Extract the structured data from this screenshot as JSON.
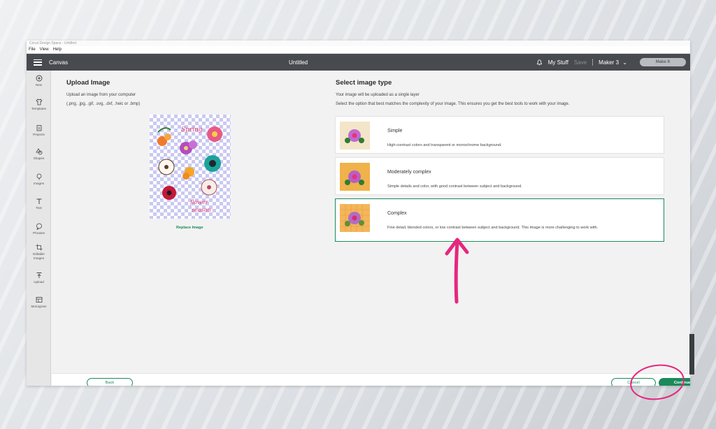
{
  "window": {
    "title": "Cricut Design Space - Untitled"
  },
  "menu": {
    "items": [
      "File",
      "View",
      "Help"
    ]
  },
  "topbar": {
    "app_label": "Canvas",
    "doc_title": "Untitled",
    "my_stuff": "My Stuff",
    "save": "Save",
    "machine": "Maker 3",
    "make_it": "Make It"
  },
  "sidebar": {
    "items": [
      {
        "label": "New",
        "icon": "plus-circle-icon"
      },
      {
        "label": "Templates",
        "icon": "shirt-icon"
      },
      {
        "label": "Projects",
        "icon": "clipboard-icon"
      },
      {
        "label": "Shapes",
        "icon": "shapes-icon"
      },
      {
        "label": "Images",
        "icon": "lightbulb-icon"
      },
      {
        "label": "Text",
        "icon": "text-t-icon"
      },
      {
        "label": "Phrases",
        "icon": "speech-bubble-icon"
      },
      {
        "label": "Editable Images",
        "icon": "crop-icon"
      },
      {
        "label": "Upload",
        "icon": "upload-arrow-icon"
      },
      {
        "label": "Monogram",
        "icon": "monogram-icon"
      }
    ]
  },
  "upload": {
    "heading": "Upload Image",
    "subtitle": "Upload an image from your computer",
    "formats": "(.png, .jpg, .gif, .svg, .dxf, .heic or .bmp)",
    "replace_label": "Replace Image"
  },
  "select": {
    "heading": "Select image type",
    "line1": "Your image will be uploaded as a single layer",
    "line2": "Select the option that best matches the complexity of your image. This ensures you get the best tools to work with your image.",
    "options": [
      {
        "name": "Simple",
        "desc": "High-contrast colors and transparent or monochrome background.",
        "selected": false,
        "thumb_bg": "#f3e5c8"
      },
      {
        "name": "Moderately complex",
        "desc": "Simple details and color, with good contrast between subject and background.",
        "selected": false,
        "thumb_bg": "#f0b24a"
      },
      {
        "name": "Complex",
        "desc": "Fine detail, blended colors, or low contrast between subject and background. This image is more challenging to work with.",
        "selected": true,
        "thumb_bg": "#f4b65a"
      }
    ]
  },
  "footer": {
    "back": "Back",
    "cancel": "Cancel",
    "continue": "Continue"
  },
  "colors": {
    "accent": "#1b8a5a",
    "annotation": "#e6277e",
    "topbar": "#474a4e"
  }
}
